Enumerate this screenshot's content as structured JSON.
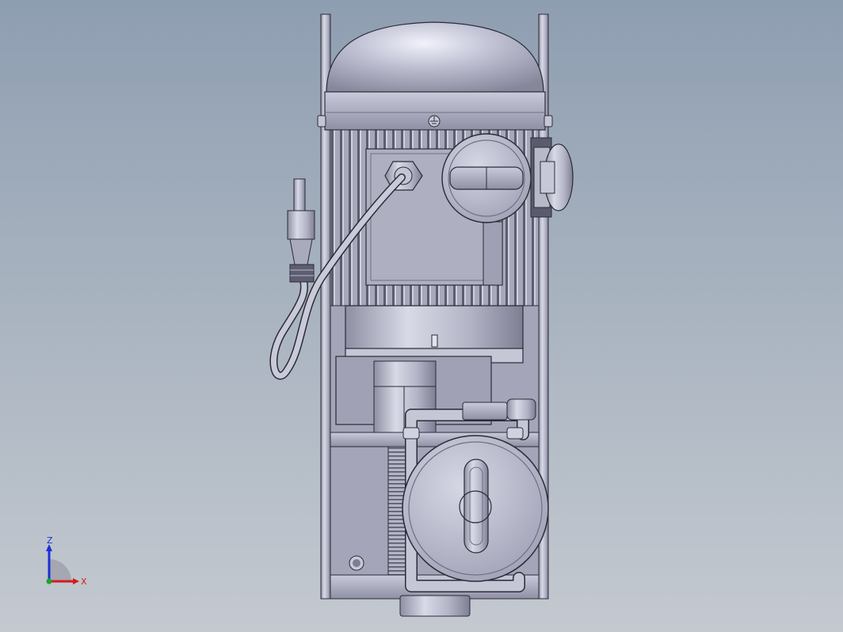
{
  "viewport": {
    "colors": {
      "bg_top": "#8e9eb1",
      "bg_bottom": "#c4c9d0",
      "metal_light": "#d4d5e3",
      "metal_mid": "#a9aabb",
      "metal_dark": "#6f7084",
      "outline": "#2b2b36"
    }
  },
  "triad": {
    "z_label": "Z",
    "x_label": "X",
    "z_color": "#1b2fd6",
    "x_color": "#d21c1c",
    "y_color": "#17a62b"
  }
}
